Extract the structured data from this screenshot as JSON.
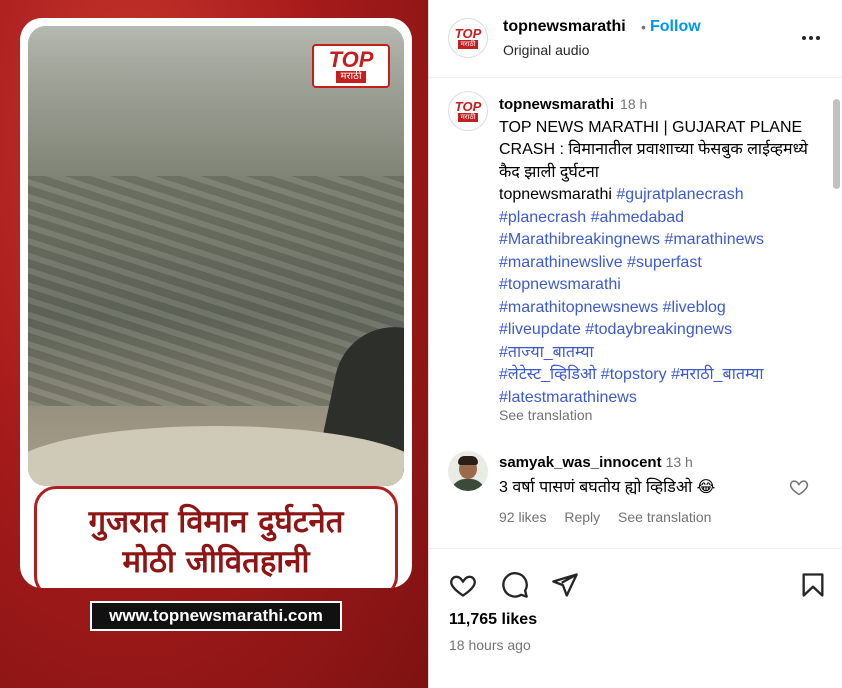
{
  "media": {
    "logo_top": "TOP",
    "logo_sub": "मराठी",
    "headline_line1": "गुजरात विमान दुर्घटनेत",
    "headline_line2": "मोठी जीवितहानी",
    "site": "www.topnewsmarathi.com"
  },
  "header": {
    "avatar_top": "TOP",
    "avatar_sub": "मराठी",
    "username": "topnewsmarathi",
    "dot": "•",
    "follow": "Follow",
    "audio": "Original audio",
    "more_icon": "more-horizontal-icon"
  },
  "caption": {
    "username": "topnewsmarathi",
    "time": "18 h",
    "text": "TOP NEWS MARATHI | GUJARAT PLANE CRASH : विमानातील प्रवाशाच्या फेसबुक लाईव्हमध्ये कैद झाली दुर्घटना",
    "mention": "topnewsmarathi",
    "hashtags": [
      "#gujratplanecrash",
      "#planecrash",
      "#ahmedabad",
      "#Marathibreakingnews",
      "#marathinews",
      "#marathinewslive",
      "#superfast",
      "#topnewsmarathi",
      "#marathitopnewsnews",
      "#liveblog",
      "#liveupdate",
      "#todaybreakingnews",
      "#ताज्या_बातम्या",
      "#लेटेस्ट_व्हिडिओ",
      "#topstory",
      "#मराठी_बातम्या",
      "#latestmarathinews"
    ],
    "see_translation": "See translation"
  },
  "comment": {
    "username": "samyak_was_innocent",
    "time": "13 h",
    "text": "3 वर्षा पासणं बघतोय ह्यो व्हिडिओ 😂",
    "likes": "92 likes",
    "reply": "Reply",
    "see_translation": "See translation"
  },
  "actions": {
    "likes": "11,765 likes",
    "time_ago": "18 hours ago"
  },
  "colors": {
    "accent": "#0095f6",
    "hashtag": "#3b5ad1",
    "brand_red": "#c41e1e"
  }
}
